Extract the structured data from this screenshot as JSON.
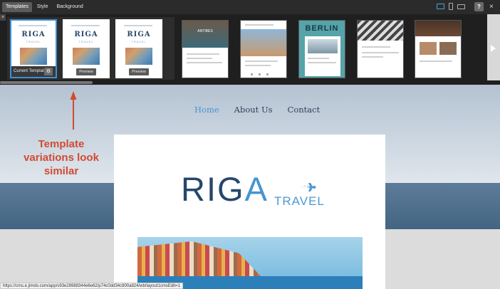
{
  "toolbar": {
    "tabs": [
      {
        "label": "Templates",
        "active": true
      },
      {
        "label": "Style",
        "active": false
      },
      {
        "label": "Background",
        "active": false
      }
    ],
    "devices": [
      "desktop-icon",
      "tablet-icon",
      "mobile-landscape-icon"
    ],
    "help_label": "?",
    "close_label": "×"
  },
  "strip": {
    "close_label": "×",
    "current_label": "Current Template",
    "preview_label": "Preview",
    "variant_logo": "RIGA",
    "variant_sub": "TRAVEL",
    "templates": [
      {
        "title": "ANTIBES"
      },
      {
        "title": ""
      },
      {
        "title": "BERLIN"
      },
      {
        "title": ""
      },
      {
        "title": ""
      },
      {
        "title": ""
      }
    ]
  },
  "site": {
    "nav": [
      "Home",
      "About Us",
      "Contact"
    ],
    "logo_main_a": "RIG",
    "logo_main_b": "A",
    "logo_sub": "TRAVEL"
  },
  "annotation": {
    "text_line1": "Template",
    "text_line2": "variations look",
    "text_line3": "similar",
    "color": "#d24a32"
  },
  "status": {
    "url": "https://cms.e.jimdo.com/app/s93e28988344e6e62/p74c0dd34c900a824/wb/layout1cmsEdit=1"
  },
  "colors": {
    "accent": "#4795d4",
    "brand_dark": "#26476d"
  }
}
